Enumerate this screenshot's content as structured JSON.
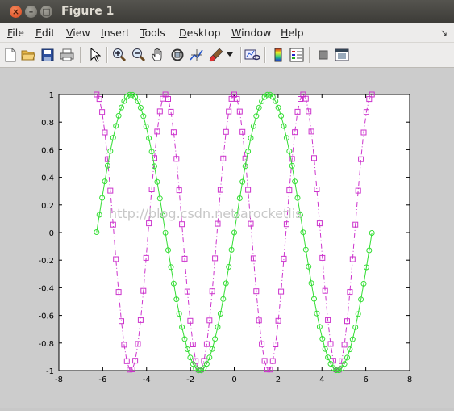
{
  "window": {
    "title": "Figure 1"
  },
  "menu": [
    {
      "label": "File",
      "underline": "F",
      "rest": "ile"
    },
    {
      "label": "Edit",
      "underline": "E",
      "rest": "dit"
    },
    {
      "label": "View",
      "underline": "V",
      "rest": "iew"
    },
    {
      "label": "Insert",
      "underline": "I",
      "rest": "nsert"
    },
    {
      "label": "Tools",
      "underline": "T",
      "rest": "ools"
    },
    {
      "label": "Desktop",
      "underline": "D",
      "rest": "esktop"
    },
    {
      "label": "Window",
      "underline": "W",
      "rest": "indow"
    },
    {
      "label": "Help",
      "underline": "H",
      "rest": "elp"
    }
  ],
  "toolbar": [
    "new-figure-icon",
    "open-file-icon",
    "save-icon",
    "print-icon",
    "pointer-icon",
    "zoom-in-icon",
    "zoom-out-icon",
    "pan-hand-icon",
    "rotate-3d-icon",
    "data-cursor-icon",
    "brush-icon",
    "link-plot-icon",
    "colorbar-icon",
    "legend-icon",
    "hide-plot-tools-icon",
    "show-plot-tools-icon"
  ],
  "watermark": "http://blog.csdn.net/arocketlis",
  "chart_data": {
    "type": "line",
    "title": "",
    "xlabel": "",
    "ylabel": "",
    "xlim": [
      -8,
      8
    ],
    "ylim": [
      -1,
      1
    ],
    "xticks": [
      "-8",
      "-6",
      "-4",
      "-2",
      "0",
      "2",
      "4",
      "6",
      "8"
    ],
    "yticks": [
      "-1",
      "-0.8",
      "-0.6",
      "-0.4",
      "-0.2",
      "0",
      "0.2",
      "0.4",
      "0.6",
      "0.8",
      "1"
    ],
    "grid": false,
    "series": [
      {
        "function": "cos(2x)",
        "x_range": [
          -6.28,
          6.28
        ],
        "n_points": 101,
        "color": "#cc33cc",
        "marker": "square",
        "line_style": "dash-dot"
      },
      {
        "function": "sin(x)",
        "x_range": [
          -6.28,
          6.28
        ],
        "n_points": 101,
        "color": "#33dd33",
        "marker": "circle",
        "line_style": "solid"
      }
    ]
  }
}
